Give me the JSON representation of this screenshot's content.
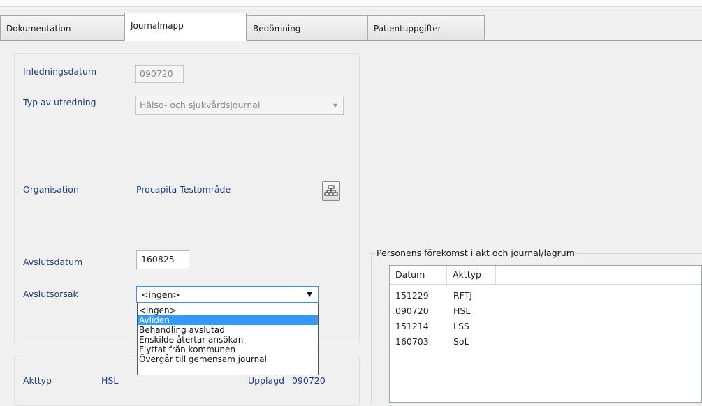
{
  "tabs": [
    {
      "label": "Dokumentation",
      "active": false
    },
    {
      "label": "Journalmapp",
      "active": true
    },
    {
      "label": "Bedömning",
      "active": false
    },
    {
      "label": "Patientuppgifter",
      "active": false
    }
  ],
  "form": {
    "inledningsdatum_label": "Inledningsdatum",
    "inledningsdatum_value": "090720",
    "typ_label": "Typ av utredning",
    "typ_value": "Hälso- och sjukvårdsjournal",
    "organisation_label": "Organisation",
    "organisation_value": "Procapita Testområde",
    "org_button_icon": "org-tree-icon",
    "avslutsdatum_label": "Avslutsdatum",
    "avslutsdatum_value": "160825",
    "avslutsorsak_label": "Avslutsorsak",
    "avslutsorsak_value": "<ingen>",
    "avslutsorsak_options": [
      "<ingen>",
      "Avliden",
      "Behandling avslutad",
      "Enskilde återtar ansökan",
      "Flyttat från kommunen",
      "Övergår till gemensam journal"
    ],
    "avslutsorsak_highlighted": "Avliden"
  },
  "bottom": {
    "akttyp_label": "Akttyp",
    "akttyp_value": "HSL",
    "upplagd_label": "Upplagd",
    "upplagd_value": "090720"
  },
  "occurrence": {
    "title": "Personens förekomst i akt och journal/lagrum",
    "columns": [
      "Datum",
      "Akttyp"
    ],
    "rows": [
      {
        "datum": "151229",
        "akttyp": "RFTJ"
      },
      {
        "datum": "090720",
        "akttyp": "HSL"
      },
      {
        "datum": "151214",
        "akttyp": "LSS"
      },
      {
        "datum": "160703",
        "akttyp": "SoL"
      }
    ]
  }
}
